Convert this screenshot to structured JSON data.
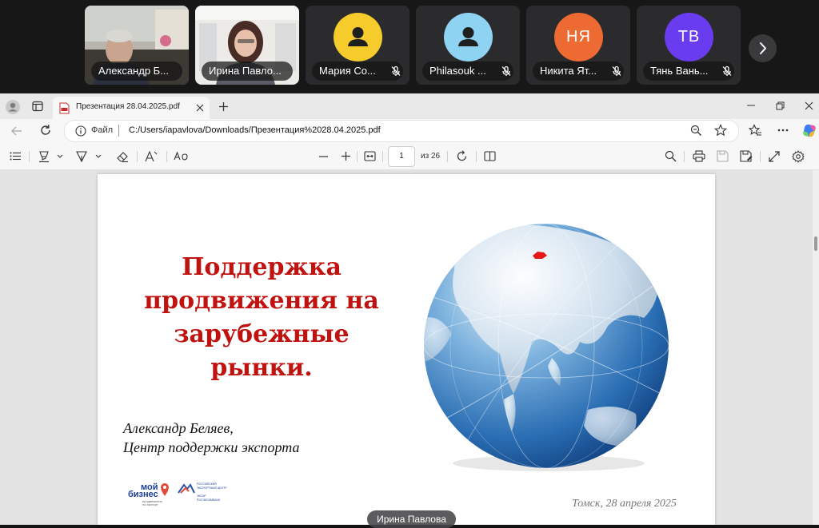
{
  "call": {
    "participants": [
      {
        "name": "Александр Б...",
        "type": "video"
      },
      {
        "name": "Ирина Павло...",
        "type": "video"
      },
      {
        "name": "Мария Со...",
        "type": "avatar-icon",
        "color": "#f5cc2c",
        "muted": true
      },
      {
        "name": "Philasouk ...",
        "type": "avatar-icon",
        "color": "#8ed3f2",
        "muted": true
      },
      {
        "name": "Никита Ят...",
        "type": "initials",
        "initials": "НЯ",
        "color": "#ee6a33",
        "muted": true
      },
      {
        "name": "Тянь Вань...",
        "type": "initials",
        "initials": "ТВ",
        "color": "#6a3cf0",
        "muted": true
      }
    ],
    "next_icon": "chevron-right-icon",
    "presenter_label": "Ирина Павлова"
  },
  "browser": {
    "tab_title": "Презентация 28.04.2025.pdf",
    "address_scheme_label": "Файл",
    "url": "C:/Users/iapavlova/Downloads/Презентация%2028.04.2025.pdf"
  },
  "pdf_toolbar": {
    "page_number": "1",
    "page_count": "из 26"
  },
  "slide": {
    "title": "Поддержка продвижения на зарубежные рынки.",
    "author_line1": "Александр Беляев,",
    "author_line2": "Центр поддержки экспорта",
    "date_location": "Томск, 28 апреля 2025",
    "logo1_word1": "мой",
    "logo1_word2": "бизнес",
    "logo1_sub1": "продвижение",
    "logo1_sub2": "на экспорт",
    "logo2_line1": "РОССИЙСКИЙ",
    "logo2_line2": "ЭКСПОРТНЫЙ ЦЕНТР",
    "logo2_line3": "ЭКСАР",
    "logo2_line4": "РОСЭКСИМБАНК",
    "accent_color": "#c0130f"
  }
}
